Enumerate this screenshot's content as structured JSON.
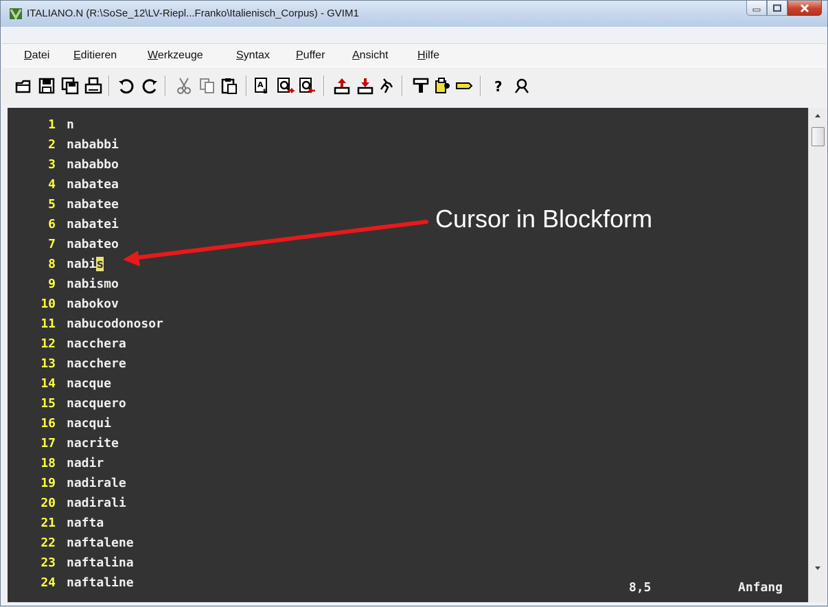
{
  "window": {
    "title": "ITALIANO.N (R:\\SoSe_12\\LV-Riepl...Franko\\Italienisch_Corpus) - GVIM1",
    "app_icon": "gvim-icon"
  },
  "window_controls": [
    "minimize-icon",
    "maximize-icon",
    "close-icon"
  ],
  "menu": [
    {
      "label_ul": "D",
      "label_rest": "atei"
    },
    {
      "label_ul": "E",
      "label_rest": "ditieren"
    },
    {
      "label_ul": "W",
      "label_rest": "erkzeuge"
    },
    {
      "label_ul": "S",
      "label_rest": "yntax"
    },
    {
      "label_ul": "P",
      "label_rest": "uffer"
    },
    {
      "label_ul": "A",
      "label_rest": "nsicht"
    },
    {
      "label_ul": "H",
      "label_rest": "ilfe"
    }
  ],
  "toolbar": {
    "icons": [
      "open-icon",
      "save-icon",
      "save-all-icon",
      "print-icon",
      "undo-icon",
      "redo-icon",
      "cut-icon",
      "copy-icon",
      "paste-icon",
      "replace-icon",
      "find-next-icon",
      "find-prev-icon",
      "load-session-icon",
      "save-session-icon",
      "run-script-icon",
      "make-icon",
      "shell-icon",
      "tags-icon",
      "help-icon",
      "find-help-icon"
    ]
  },
  "editor": {
    "lines": [
      {
        "num": "1",
        "text": "n"
      },
      {
        "num": "2",
        "text": "nababbi"
      },
      {
        "num": "3",
        "text": "nababbo"
      },
      {
        "num": "4",
        "text": "nabatea"
      },
      {
        "num": "5",
        "text": "nabatee"
      },
      {
        "num": "6",
        "text": "nabatei"
      },
      {
        "num": "7",
        "text": "nabateo"
      },
      {
        "num": "8",
        "text_before": "nabi",
        "cursor_char": "s"
      },
      {
        "num": "9",
        "text": "nabismo"
      },
      {
        "num": "10",
        "text": "nabokov"
      },
      {
        "num": "11",
        "text": "nabucodonosor"
      },
      {
        "num": "12",
        "text": "nacchera"
      },
      {
        "num": "13",
        "text": "nacchere"
      },
      {
        "num": "14",
        "text": "nacque"
      },
      {
        "num": "15",
        "text": "nacquero"
      },
      {
        "num": "16",
        "text": "nacqui"
      },
      {
        "num": "17",
        "text": "nacrite"
      },
      {
        "num": "18",
        "text": "nadir"
      },
      {
        "num": "19",
        "text": "nadirale"
      },
      {
        "num": "20",
        "text": "nadirali"
      },
      {
        "num": "21",
        "text": "nafta"
      },
      {
        "num": "22",
        "text": "naftalene"
      },
      {
        "num": "23",
        "text": "naftalina"
      },
      {
        "num": "24",
        "text": "naftaline"
      }
    ],
    "cursor_position": "8,5",
    "scroll_position": "Anfang"
  },
  "annotation": {
    "text": "Cursor in Blockform",
    "color": "#e8191a"
  },
  "colors": {
    "editor_bg": "#333333",
    "line_number": "#ffff40",
    "text": "#f0f0f0",
    "cursor": "#e8e07a"
  }
}
